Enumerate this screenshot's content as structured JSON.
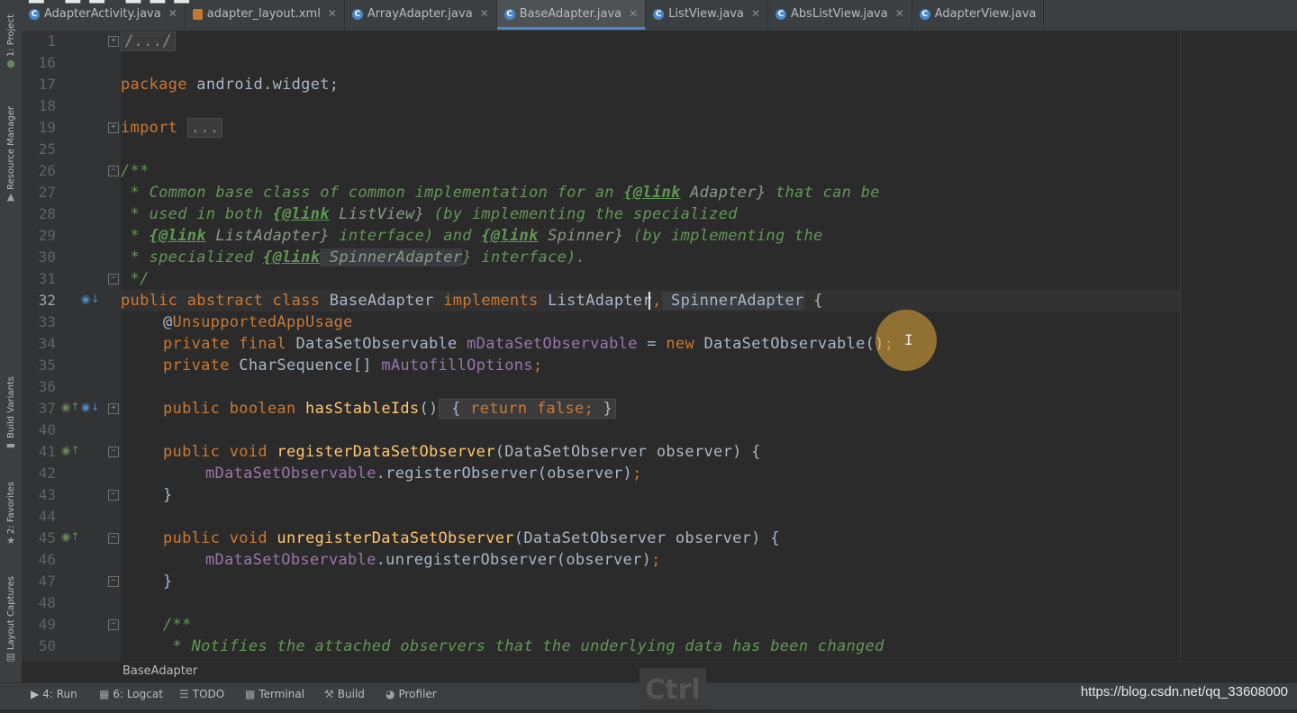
{
  "tabs": [
    {
      "label": "AdapterActivity.java",
      "icon": "java-class-icon",
      "active": false
    },
    {
      "label": "adapter_layout.xml",
      "icon": "xml-file-icon",
      "active": false
    },
    {
      "label": "ArrayAdapter.java",
      "icon": "java-class-icon",
      "active": false
    },
    {
      "label": "BaseAdapter.java",
      "icon": "java-class-icon",
      "active": true
    },
    {
      "label": "ListView.java",
      "icon": "java-class-icon",
      "active": false
    },
    {
      "label": "AbsListView.java",
      "icon": "java-class-icon",
      "active": false
    },
    {
      "label": "AdapterView.java",
      "icon": "java-class-icon",
      "active": false
    }
  ],
  "left_tools": {
    "project": "1: Project",
    "resource_manager": "Resource Manager",
    "build_variants": "Build Variants",
    "favorites": "2: Favorites",
    "layout_captures": "Layout Captures"
  },
  "line_numbers": [
    "1",
    "16",
    "17",
    "18",
    "19",
    "25",
    "26",
    "27",
    "28",
    "29",
    "30",
    "31",
    "32",
    "33",
    "34",
    "35",
    "36",
    "37",
    "40",
    "41",
    "42",
    "43",
    "44",
    "45",
    "46",
    "47",
    "48",
    "49",
    "50"
  ],
  "current_line": "32",
  "code": {
    "l1": "/.../",
    "l17_kw": "package",
    "l17_name": " android.widget;",
    "l19_kw": "import",
    "l19_fold": "...",
    "l26": "/**",
    "l27_a": " * Common base class of common implementation for an ",
    "l27_tag": "{@link",
    "l27_ref": " Adapter}",
    "l27_b": " that can be",
    "l28_a": " * used in both ",
    "l28_tag": "{@link",
    "l28_ref": " ListView}",
    "l28_b": " (by implementing the specialized",
    "l29_a": " * ",
    "l29_tag": "{@link",
    "l29_ref": " ListAdapter}",
    "l29_b": " interface) and ",
    "l29_tag2": "{@link",
    "l29_ref2": " Spinner}",
    "l29_c": " (by implementing the",
    "l30_a": " * specialized ",
    "l30_tag": "{@link",
    "l30_ref": " SpinnerAdapter",
    "l30_b": "} interface).",
    "l31": " */",
    "l32_kw": "public abstract class",
    "l32_name": " BaseAdapter ",
    "l32_kw2": "implements",
    "l32_i1": " ListAdapter",
    "l32_comma": ",",
    "l32_i2": " SpinnerAdapter",
    "l32_end": " {",
    "l33_at": "@",
    "l33_ann": "UnsupportedAppUsage",
    "l34_kw": "private final",
    "l34_type": " DataSetObservable ",
    "l34_fld": "mDataSetObservable",
    "l34_eq": " = ",
    "l34_new": "new",
    "l34_rest": " DataSetObservable()",
    "l34_semi": ";",
    "l35_kw": "private",
    "l35_type": " CharSequence[] ",
    "l35_fld": "mAutofillOptions",
    "l35_semi": ";",
    "l37_kw": "public boolean",
    "l37_fn": " hasStableIds",
    "l37_paren": "()",
    "l37_body_open": " {",
    "l37_ret": " return false",
    "l37_semi": ";",
    "l37_body_close": " }",
    "l41_kw": "public void",
    "l41_fn": " registerDataSetObserver",
    "l41_params": "(DataSetObserver observer) {",
    "l42_fld": "mDataSetObservable",
    "l42_call": ".registerObserver(observer)",
    "l42_semi": ";",
    "l43": "}",
    "l45_kw": "public void",
    "l45_fn": " unregisterDataSetObserver",
    "l45_params": "(DataSetObserver observer) {",
    "l46_fld": "mDataSetObservable",
    "l46_call": ".unregisterObserver(observer)",
    "l46_semi": ";",
    "l47": "}",
    "l49": "/**",
    "l50": " * Notifies the attached observers that the underlying data has been changed"
  },
  "breadcrumb": "BaseAdapter",
  "bottom_tools": [
    {
      "label": "4: Run",
      "icon": "run-icon"
    },
    {
      "label": "6: Logcat",
      "icon": "logcat-icon"
    },
    {
      "label": "TODO",
      "icon": "todo-icon"
    },
    {
      "label": "Terminal",
      "icon": "terminal-icon"
    },
    {
      "label": "Build",
      "icon": "build-icon"
    },
    {
      "label": "Profiler",
      "icon": "profiler-icon"
    }
  ],
  "overlay_key": "Ctrl",
  "watermark": "https://blog.csdn.net/qq_33608000",
  "colors": {
    "background": "#2b2b2b",
    "keyword": "#cc7832",
    "method": "#ffc66d",
    "field": "#9876aa",
    "doc": "#629755",
    "accent": "#4a88c7"
  }
}
